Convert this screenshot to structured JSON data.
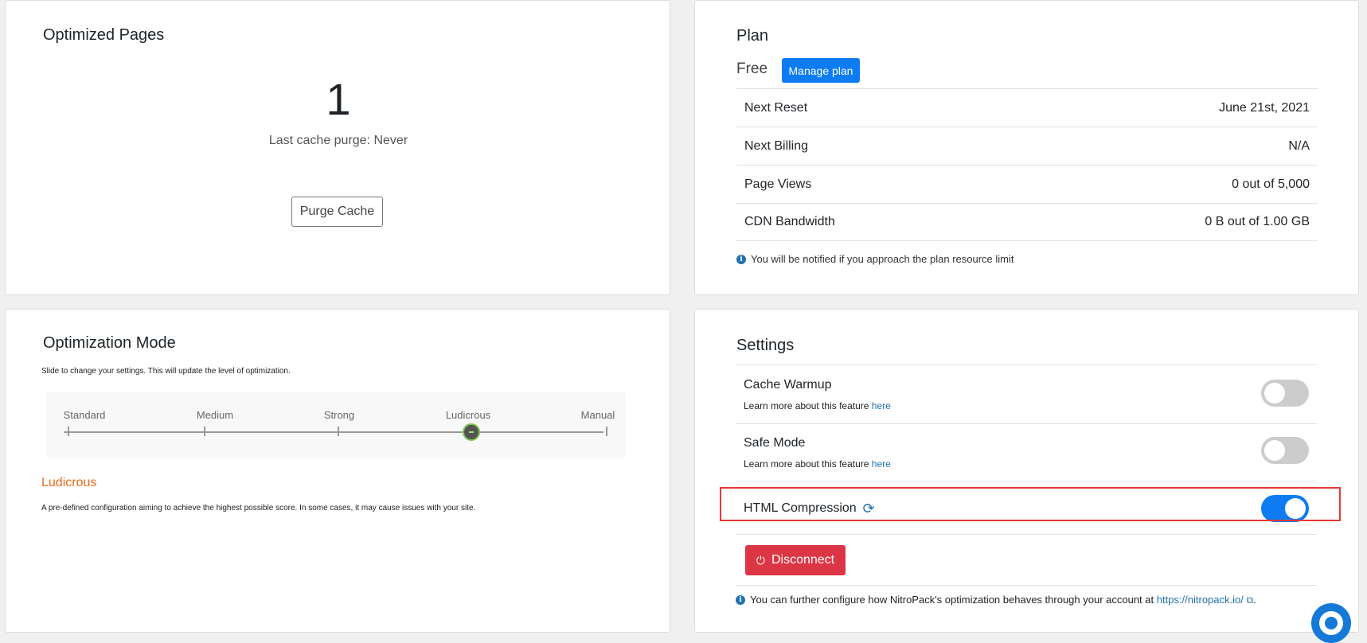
{
  "optimized": {
    "title": "Optimized Pages",
    "count": "1",
    "last_purge": "Last cache purge: Never",
    "purge_label": "Purge Cache"
  },
  "plan": {
    "title": "Plan",
    "name": "Free",
    "manage_label": "Manage plan",
    "rows": [
      {
        "label": "Next Reset",
        "value": "June 21st, 2021"
      },
      {
        "label": "Next Billing",
        "value": "N/A"
      },
      {
        "label": "Page Views",
        "value": "0 out of 5,000"
      },
      {
        "label": "CDN Bandwidth",
        "value": "0 B out of 1.00 GB"
      }
    ],
    "note": "You will be notified if you approach the plan resource limit"
  },
  "mode": {
    "title": "Optimization Mode",
    "description": "Slide to change your settings. This will update the level of optimization.",
    "levels": [
      "Standard",
      "Medium",
      "Strong",
      "Ludicrous",
      "Manual"
    ],
    "selected_index": 3,
    "selected_name": "Ludicrous",
    "selected_description": "A pre-defined configuration aiming to achieve the highest possible score. In some cases, it may cause issues with your site.",
    "accent_color": "#e8691b"
  },
  "settings": {
    "title": "Settings",
    "cache_warmup": {
      "label": "Cache Warmup",
      "sub": "Learn more about this feature ",
      "link": "here",
      "enabled": false
    },
    "safe_mode": {
      "label": "Safe Mode",
      "sub": "Learn more about this feature ",
      "link": "here",
      "enabled": false
    },
    "html_compression": {
      "label": "HTML Compression",
      "enabled": true
    },
    "disconnect_label": "Disconnect",
    "note_prefix": "You can further configure how NitroPack's optimization behaves through your account at ",
    "note_link": "https://nitropack.io/",
    "note_suffix": "."
  },
  "icons": {
    "info": "info-icon",
    "refresh": "refresh-icon",
    "power": "power-icon",
    "external": "external-link-icon",
    "help": "lifebuoy-icon"
  },
  "colors": {
    "primary": "#0d7cf2",
    "danger": "#dc3545",
    "highlight": "#e53935"
  }
}
